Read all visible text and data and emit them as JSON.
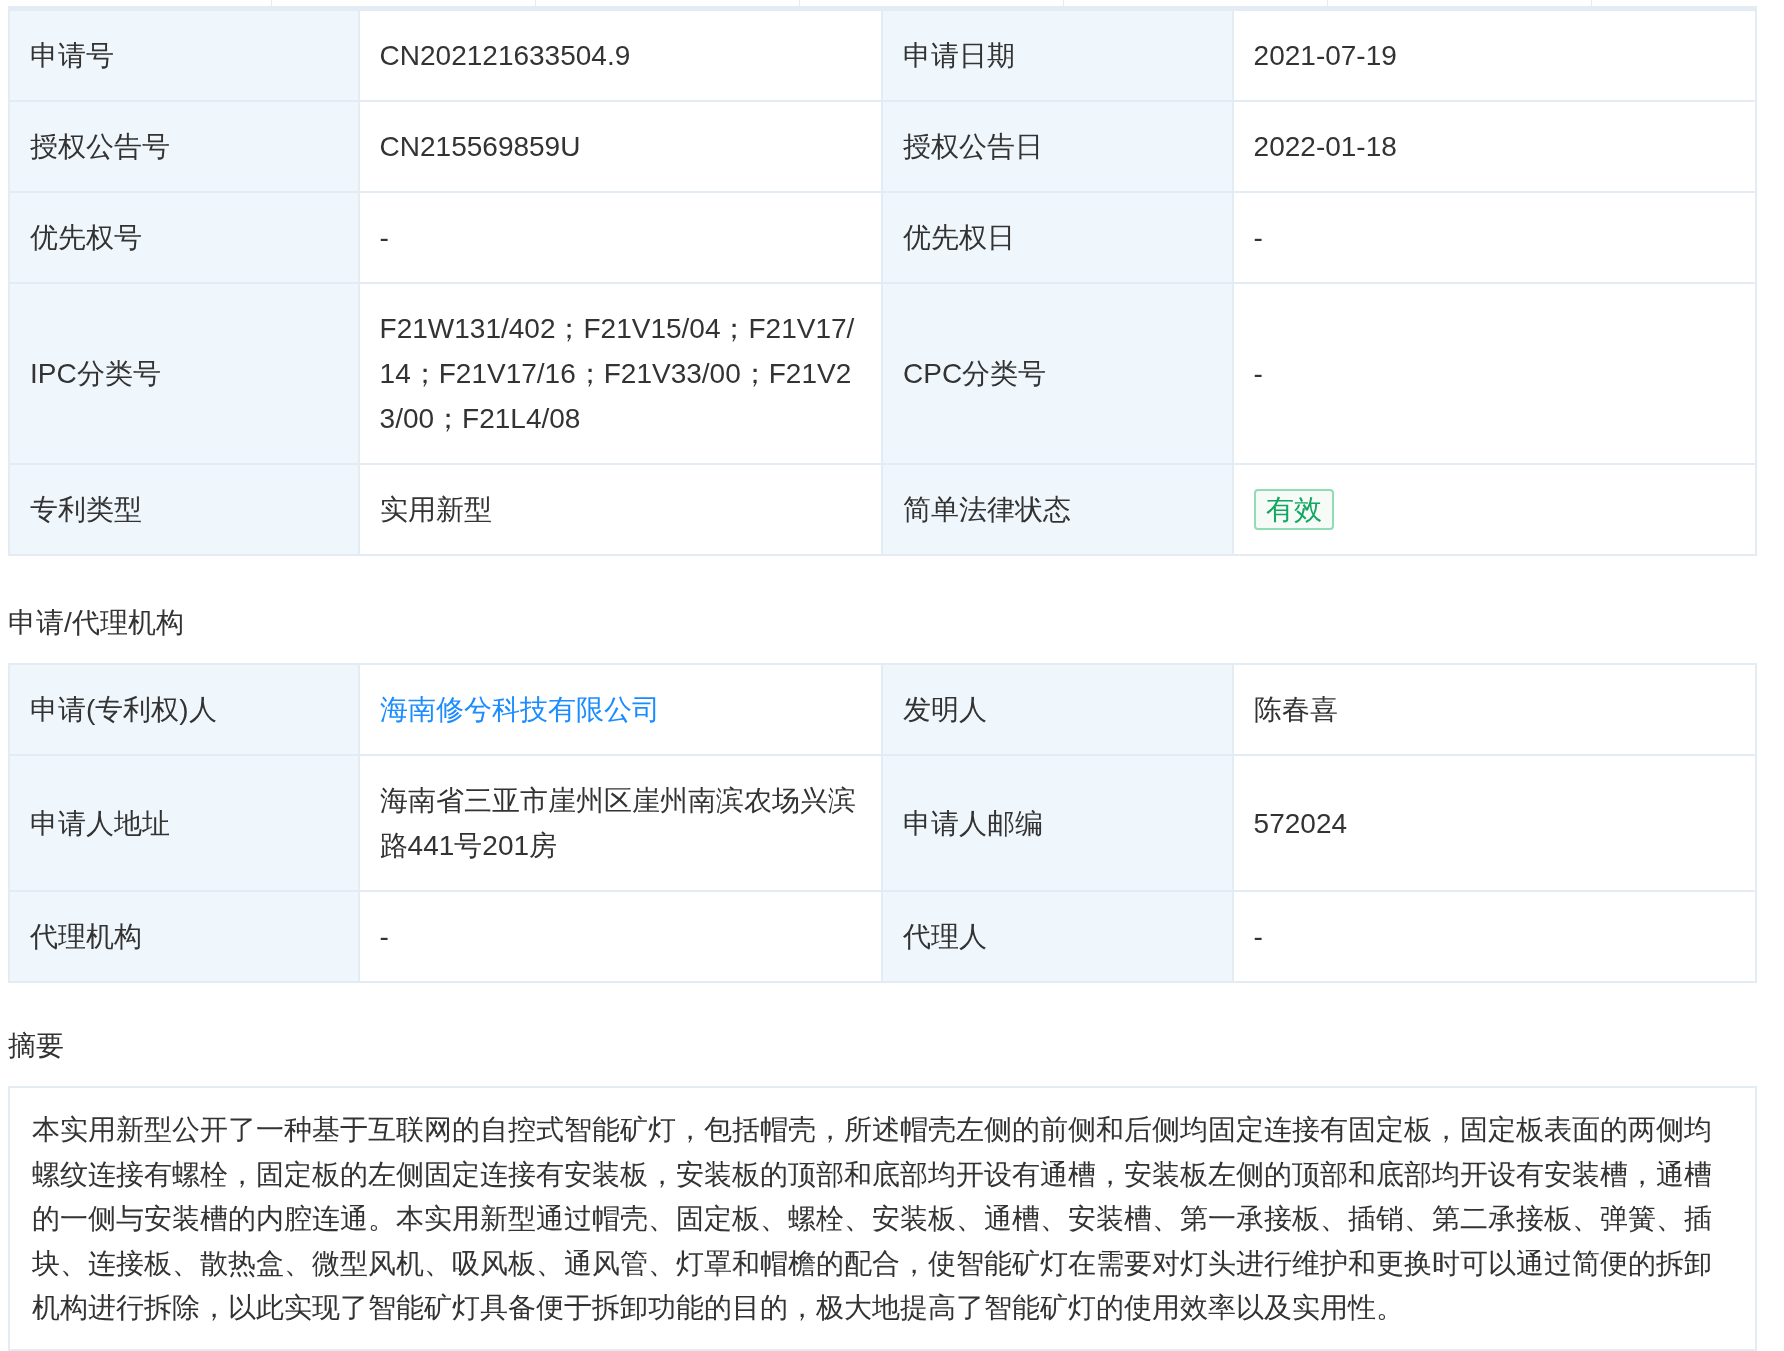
{
  "sections": [
    {
      "rows": [
        [
          {
            "label": "申请号",
            "kind": "text",
            "value": "CN202121633504.9"
          },
          {
            "label": "申请日期",
            "kind": "text",
            "value": "2021-07-19"
          }
        ],
        [
          {
            "label": "授权公告号",
            "kind": "text",
            "value": "CN215569859U"
          },
          {
            "label": "授权公告日",
            "kind": "text",
            "value": "2022-01-18"
          }
        ],
        [
          {
            "label": "优先权号",
            "kind": "text",
            "value": "-"
          },
          {
            "label": "优先权日",
            "kind": "text",
            "value": "-"
          }
        ],
        [
          {
            "label": "IPC分类号",
            "kind": "text",
            "value": "F21W131/402；F21V15/04；F21V17/14；F21V17/16；F21V33/00；F21V23/00；F21L4/08"
          },
          {
            "label": "CPC分类号",
            "kind": "text",
            "value": "-"
          }
        ],
        [
          {
            "label": "专利类型",
            "kind": "text",
            "value": "实用新型"
          },
          {
            "label": "简单法律状态",
            "kind": "tag",
            "value": "有效"
          }
        ]
      ]
    },
    {
      "title": "申请/代理机构",
      "rows": [
        [
          {
            "label": "申请(专利权)人",
            "kind": "link",
            "value": "海南修兮科技有限公司"
          },
          {
            "label": "发明人",
            "kind": "text",
            "value": "陈春喜"
          }
        ],
        [
          {
            "label": "申请人地址",
            "kind": "text",
            "value": "海南省三亚市崖州区崖州南滨农场兴滨路441号201房"
          },
          {
            "label": "申请人邮编",
            "kind": "text",
            "value": "572024"
          }
        ],
        [
          {
            "label": "代理机构",
            "kind": "text",
            "value": "-"
          },
          {
            "label": "代理人",
            "kind": "text",
            "value": "-"
          }
        ]
      ]
    }
  ],
  "abstract": {
    "title": "摘要",
    "text": "本实用新型公开了一种基于互联网的自控式智能矿灯，包括帽壳，所述帽壳左侧的前侧和后侧均固定连接有固定板，固定板表面的两侧均螺纹连接有螺栓，固定板的左侧固定连接有安装板，安装板的顶部和底部均开设有通槽，安装板左侧的顶部和底部均开设有安装槽，通槽的一侧与安装槽的内腔连通。本实用新型通过帽壳、固定板、螺栓、安装板、通槽、安装槽、第一承接板、插销、第二承接板、弹簧、插块、连接板、散热盒、微型风机、吸风板、通风管、灯罩和帽檐的配合，使智能矿灯在需要对灯头进行维护和更换时可以通过简便的拆卸机构进行拆除，以此实现了智能矿灯具备便于拆卸功能的目的，极大地提高了智能矿灯的使用效率以及实用性。"
  }
}
